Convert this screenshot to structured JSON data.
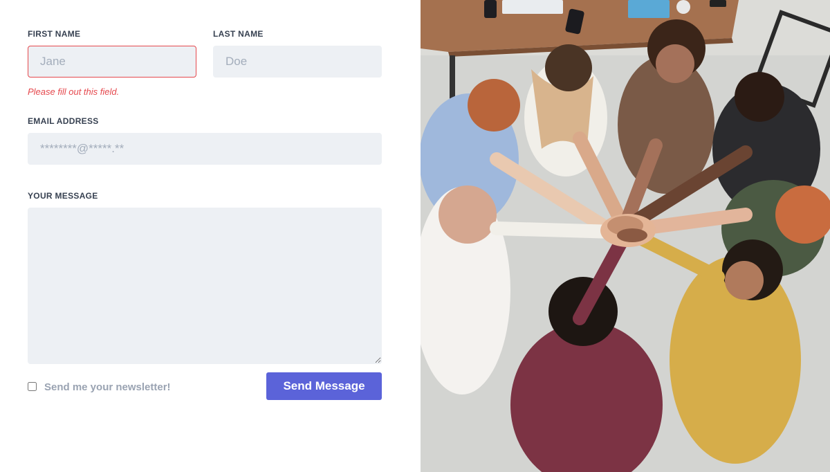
{
  "form": {
    "first_name": {
      "label": "FIRST NAME",
      "placeholder": "Jane",
      "value": "",
      "error": "Please fill out this field."
    },
    "last_name": {
      "label": "LAST NAME",
      "placeholder": "Doe",
      "value": ""
    },
    "email": {
      "label": "EMAIL ADDRESS",
      "placeholder": "********@*****.**",
      "value": ""
    },
    "message": {
      "label": "YOUR MESSAGE",
      "placeholder": "",
      "value": ""
    },
    "newsletter": {
      "label": "Send me your newsletter!",
      "checked": false
    },
    "submit_label": "Send Message"
  },
  "colors": {
    "accent": "#5b63d9",
    "error": "#e5484d",
    "field_bg": "#edf0f4"
  },
  "photo": {
    "subject": "team-hands-together-photo"
  }
}
